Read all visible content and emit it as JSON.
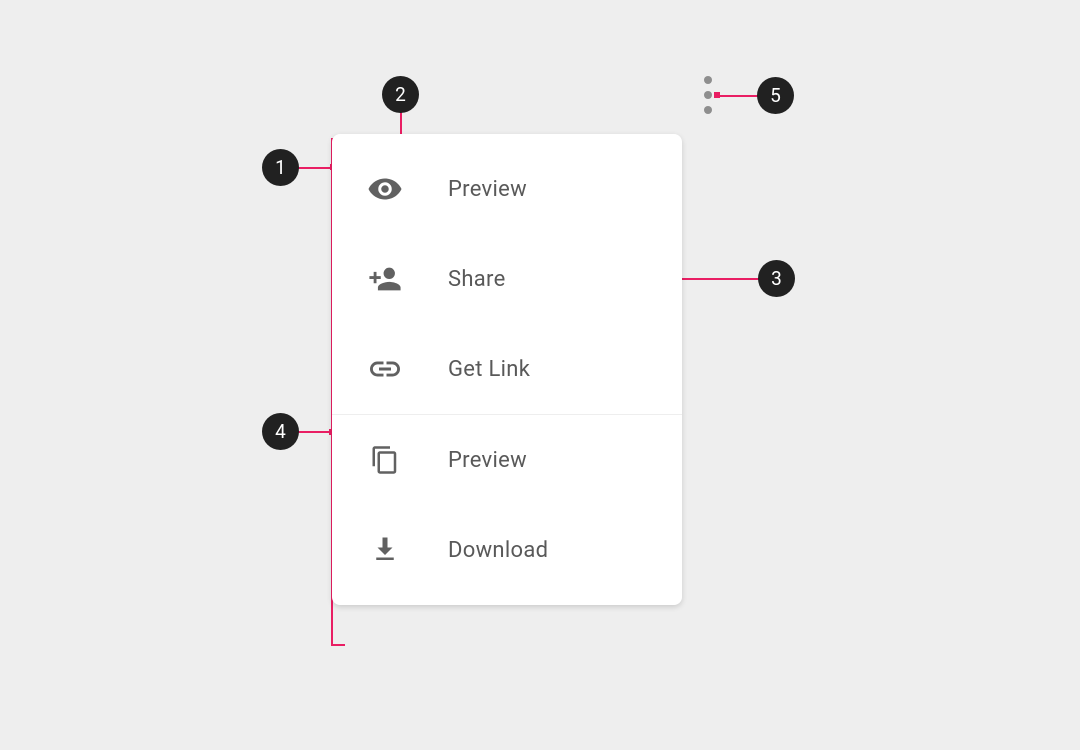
{
  "menu": {
    "sections": [
      {
        "items": [
          {
            "icon": "eye-icon",
            "label": "Preview"
          },
          {
            "icon": "person-add-icon",
            "label": "Share"
          },
          {
            "icon": "link-icon",
            "label": "Get Link"
          }
        ]
      },
      {
        "items": [
          {
            "icon": "copy-icon",
            "label": "Preview"
          },
          {
            "icon": "download-icon",
            "label": "Download"
          }
        ]
      }
    ]
  },
  "overflow": {
    "name": "more-vert-icon"
  },
  "callouts": {
    "1": "1",
    "2": "2",
    "3": "3",
    "4": "4",
    "5": "5"
  }
}
